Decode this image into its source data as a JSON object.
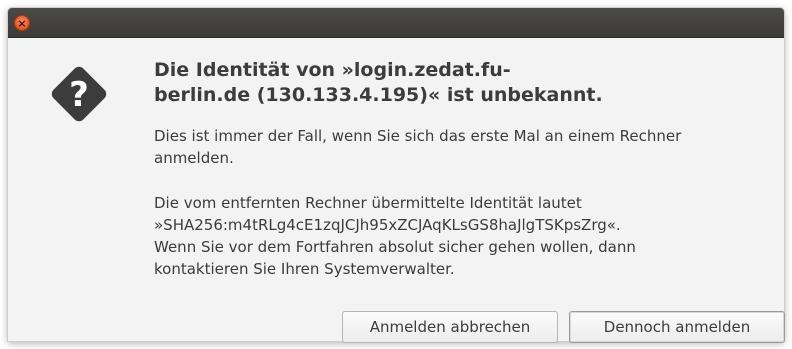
{
  "window": {
    "close_icon": "close-icon",
    "accent_color": "#e95420"
  },
  "dialog": {
    "icon": "question-icon",
    "heading_line1": "Die Identität von »login.zedat.fu-",
    "heading_line2": "berlin.de (130.133.4.195)« ist unbekannt.",
    "para1_line1": "Dies ist immer der Fall, wenn Sie sich das erste Mal an einem Rechner",
    "para1_line2": "anmelden.",
    "para2_line1": "Die vom entfernten Rechner übermittelte Identität lautet",
    "para2_line2": "»SHA256:m4tRLg4cE1zqJCJh95xZCJAqKLsGS8haJlgTSKpsZrg«.",
    "para2_line3": "Wenn Sie vor dem Fortfahren absolut sicher gehen wollen, dann",
    "para2_line4": "kontaktieren Sie Ihren Systemverwalter."
  },
  "buttons": {
    "cancel_label": "Anmelden abbrechen",
    "confirm_label": "Dennoch anmelden"
  }
}
